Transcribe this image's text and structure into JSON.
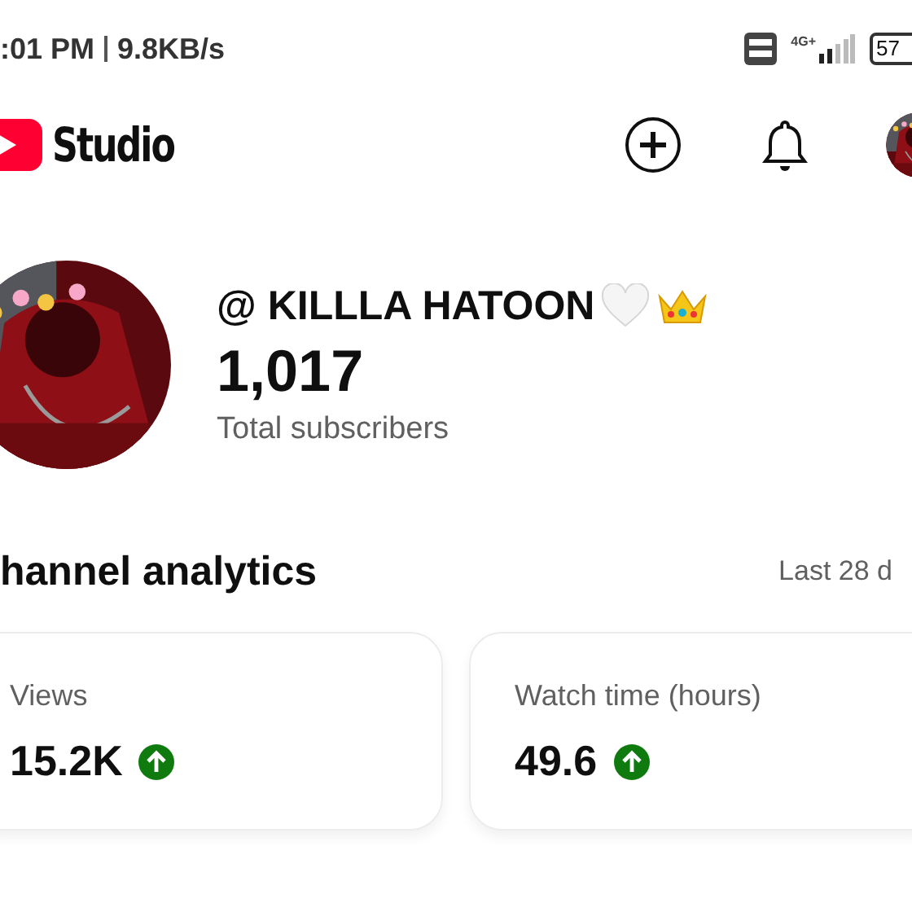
{
  "status_bar": {
    "time": ":01 PM",
    "speed": "9.8KB/s",
    "network": "4G+",
    "battery": "57"
  },
  "header": {
    "logo_text": "Studio"
  },
  "channel": {
    "name": "@ KILLLA HATOON",
    "subscribers": "1,017",
    "subscribers_label": "Total subscribers"
  },
  "analytics": {
    "title": "hannel analytics",
    "period": "Last 28 d",
    "cards": [
      {
        "label": "Views",
        "value": "15.2K",
        "rising": true
      },
      {
        "label": "Watch time (hours)",
        "value": "49.6",
        "rising": true
      }
    ]
  }
}
